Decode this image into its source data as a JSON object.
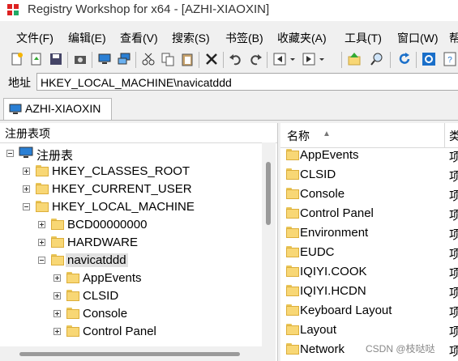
{
  "window": {
    "title": "Registry Workshop for x64 - [AZHI-XIAOXIN]"
  },
  "menu": [
    "文件(F)",
    "编辑(E)",
    "查看(V)",
    "搜索(S)",
    "书签(B)",
    "收藏夹(A)",
    "工具(T)",
    "窗口(W)",
    "帮"
  ],
  "address": {
    "label": "地址",
    "value": "HKEY_LOCAL_MACHINE\\navicatddd"
  },
  "tab": {
    "label": "AZHI-XIAOXIN"
  },
  "tree": {
    "header": "注册表项",
    "root": "注册表",
    "hkcr": "HKEY_CLASSES_ROOT",
    "hkcu": "HKEY_CURRENT_USER",
    "hklm": "HKEY_LOCAL_MACHINE",
    "bcd": "BCD00000000",
    "hardware": "HARDWARE",
    "navicat": "navicatddd",
    "appevents": "AppEvents",
    "clsid": "CLSID",
    "console": "Console",
    "controlpanel": "Control Panel"
  },
  "list": {
    "col_name": "名称",
    "col_type": "类",
    "type_value": "项",
    "items": [
      "AppEvents",
      "CLSID",
      "Console",
      "Control Panel",
      "Environment",
      "EUDC",
      "IQIYI.COOK",
      "IQIYI.HCDN",
      "Keyboard Layout",
      "Layout",
      "Network"
    ]
  },
  "watermark": "CSDN @枝哒哒"
}
